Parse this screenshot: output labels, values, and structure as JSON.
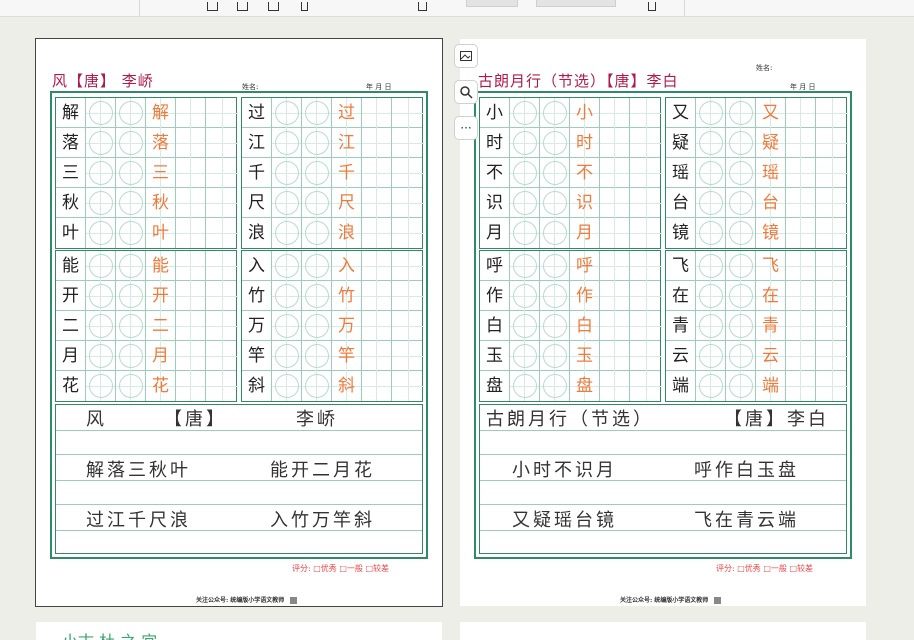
{
  "colors": {
    "accent": "#2e8b66",
    "title": "#b01a4a",
    "trace": "#f07a3c",
    "score": "#e44"
  },
  "icons": {
    "toolbar": [
      "sidebar-icon",
      "page-icon",
      "two-page-icon",
      "fit-icon",
      "crop-icon",
      "view-icon"
    ],
    "float": [
      "image-edit-icon",
      "search-icon",
      "more-icon"
    ]
  },
  "float_tools": {
    "more": "···"
  },
  "pages": [
    {
      "title": "风【唐】 李峤",
      "name_label": "姓名:",
      "date_label": "年    月    日",
      "blocks": [
        [
          "解",
          "落",
          "三",
          "秋",
          "叶"
        ],
        [
          "过",
          "江",
          "千",
          "尺",
          "浪"
        ],
        [
          "能",
          "开",
          "二",
          "月",
          "花"
        ],
        [
          "入",
          "竹",
          "万",
          "竿",
          "斜"
        ]
      ],
      "copy_lines": [
        [
          "风",
          "【唐】",
          "李峤"
        ],
        [
          "解落三秋叶",
          "能开二月花"
        ],
        [
          "过江千尺浪",
          "入竹万竿斜"
        ]
      ],
      "evaluation": "评分: □优秀 □一般 □较差",
      "footer": "关注公众号: 统编版小学语文教师"
    },
    {
      "title": "古朗月行（节选）【唐】李白",
      "name_label": "姓名:",
      "date_label": "年    月    日",
      "blocks": [
        [
          "小",
          "时",
          "不",
          "识",
          "月"
        ],
        [
          "又",
          "疑",
          "瑶",
          "台",
          "镜"
        ],
        [
          "呼",
          "作",
          "白",
          "玉",
          "盘"
        ],
        [
          "飞",
          "在",
          "青",
          "云",
          "端"
        ]
      ],
      "copy_lines": [
        [
          "古朗月行（节选）",
          "【唐】李白"
        ],
        [
          "小时不识月",
          "呼作白玉盘"
        ],
        [
          "又疑瑶台镜",
          "飞在青云端"
        ]
      ],
      "evaluation": "评分: □优秀 □一般 □较差",
      "footer": "关注公众号: 统编版小学语文教师"
    }
  ],
  "next_page_title": "小古 杜 之 宜"
}
